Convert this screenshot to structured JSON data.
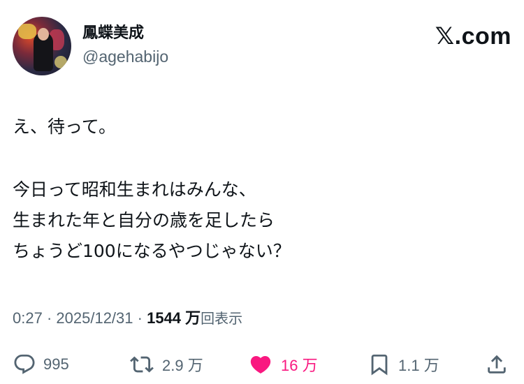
{
  "user": {
    "display_name": "鳳蝶美成",
    "handle": "@agehabijo"
  },
  "brand": {
    "logo_text": ".com"
  },
  "tweet": {
    "lines": [
      "え、待って。",
      "",
      "今日って昭和生まれはみんな、",
      "生まれた年と自分の歳を足したら",
      "ちょうど100になるやつじゃない？"
    ]
  },
  "meta": {
    "time": "0:27",
    "separator": "·",
    "date": "2025/12/31",
    "views_count": "1544 万",
    "views_label": "回表示"
  },
  "actions": {
    "reply": {
      "icon": "reply-icon",
      "count": "995"
    },
    "repost": {
      "icon": "repost-icon",
      "count": "2.9 万"
    },
    "like": {
      "icon": "heart-icon",
      "count": "16 万",
      "color": "#f91880"
    },
    "bookmark": {
      "icon": "bookmark-icon",
      "count": "1.1 万"
    },
    "share": {
      "icon": "share-icon"
    }
  },
  "colors": {
    "text_primary": "#0f1419",
    "text_secondary": "#536471",
    "like_accent": "#f91880"
  }
}
